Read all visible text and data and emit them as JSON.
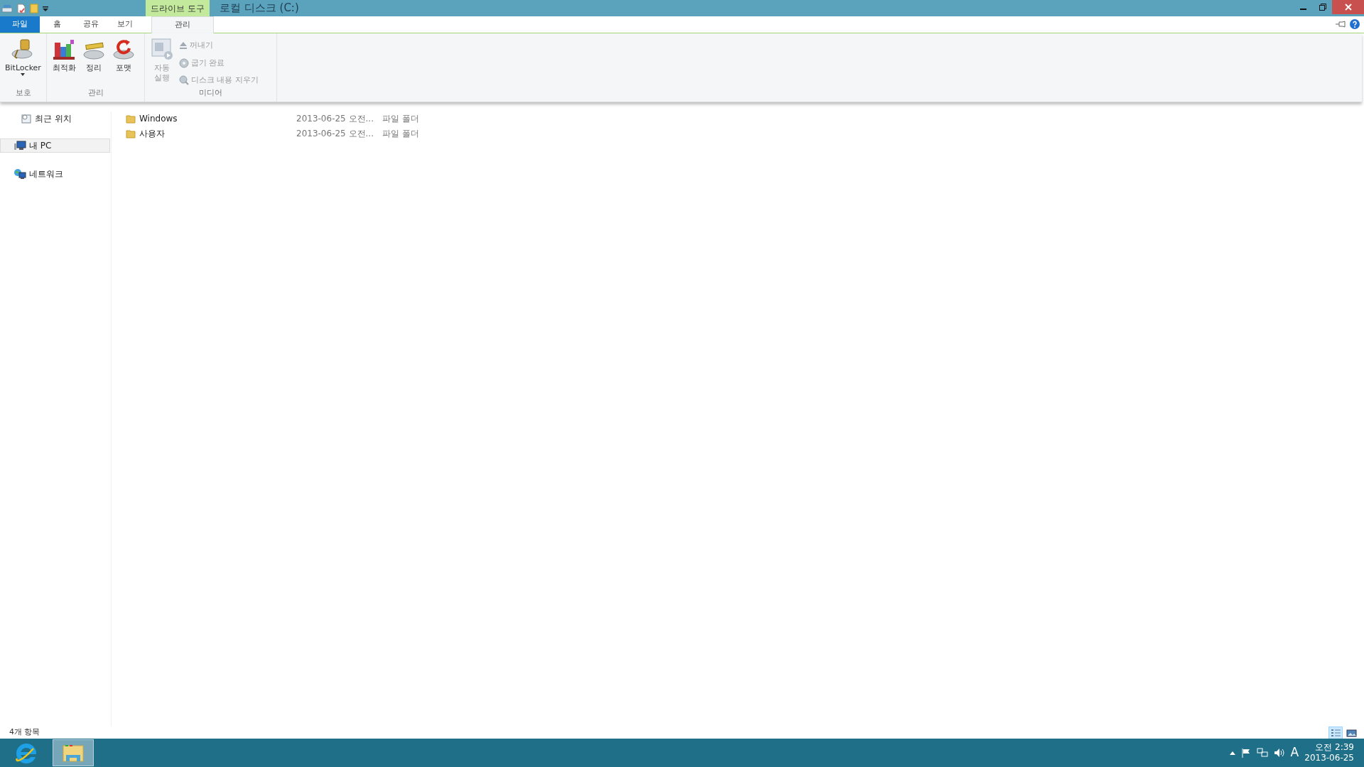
{
  "window": {
    "title": "로컬 디스크 (C:)",
    "context_group": "드라이브 도구"
  },
  "ribbon_tabs": [
    {
      "label": "파일",
      "kind": "file",
      "selected": false
    },
    {
      "label": "홈",
      "kind": "tab",
      "selected": false
    },
    {
      "label": "공유",
      "kind": "tab",
      "selected": false
    },
    {
      "label": "보기",
      "kind": "tab",
      "selected": false
    },
    {
      "label": "관리",
      "kind": "context",
      "selected": true
    }
  ],
  "ribbon_groups": [
    {
      "label": "보호",
      "buttons": [
        {
          "label": "BitLocker",
          "kind": "large",
          "disabled": false,
          "dropdown": true
        }
      ]
    },
    {
      "label": "관리",
      "buttons": [
        {
          "label": "최적화",
          "kind": "large",
          "disabled": false
        },
        {
          "label": "정리",
          "kind": "large",
          "disabled": false
        },
        {
          "label": "포맷",
          "kind": "large",
          "disabled": false
        }
      ]
    },
    {
      "label": "미디어",
      "buttons": [
        {
          "label": "자동\n실행",
          "kind": "large",
          "disabled": true
        },
        {
          "label": "꺼내기",
          "kind": "small",
          "disabled": true
        },
        {
          "label": "굽기 완료",
          "kind": "small",
          "disabled": true
        },
        {
          "label": "디스크 내용 지우기",
          "kind": "small",
          "disabled": true
        }
      ]
    }
  ],
  "nav_items": [
    {
      "label": "최근 위치",
      "kind": "child",
      "selected": false
    },
    {
      "label": "내 PC",
      "kind": "root",
      "selected": true
    },
    {
      "label": "네트워크",
      "kind": "root",
      "selected": false
    }
  ],
  "files": [
    {
      "name": "Windows",
      "date": "2013-06-25 오전...",
      "type": "파일 폴더"
    },
    {
      "name": "사용자",
      "date": "2013-06-25 오전...",
      "type": "파일 폴더"
    }
  ],
  "status_bar": {
    "item_count": "4개 항목",
    "views": [
      {
        "kind": "details",
        "selected": true
      },
      {
        "kind": "large",
        "selected": false
      }
    ]
  },
  "taskbar": {
    "apps": [
      {
        "kind": "browser",
        "selected": false
      },
      {
        "kind": "explorer",
        "selected": true
      }
    ],
    "input_mode": "A",
    "time": "오전 2:39",
    "date": "2013-06-25"
  }
}
